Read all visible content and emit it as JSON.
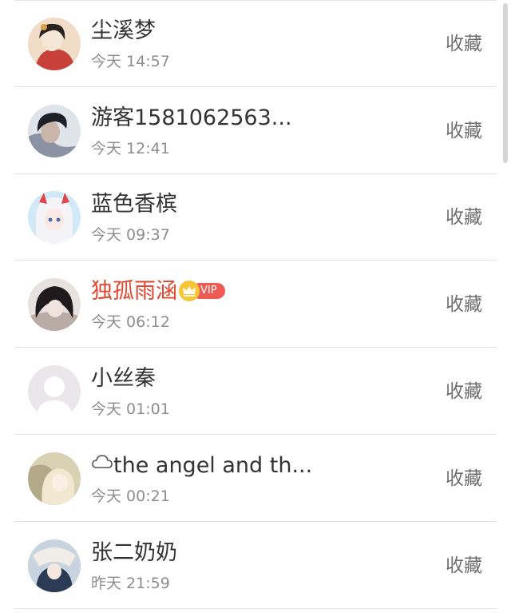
{
  "list": {
    "action_label": "收藏",
    "items": [
      {
        "name": "尘溪梦",
        "time": "今天 14:57",
        "vip": false,
        "avatar": "avatar-girl-red-dress",
        "avatar_colors": [
          "#f1ddc7",
          "#c8403a",
          "#2b2220"
        ]
      },
      {
        "name": "游客1581062563...",
        "time": "今天 12:41",
        "vip": false,
        "avatar": "avatar-boy-dark",
        "avatar_colors": [
          "#dfe3ea",
          "#1e2028",
          "#8a92a4"
        ]
      },
      {
        "name": "蓝色香槟",
        "time": "今天 09:37",
        "vip": false,
        "avatar": "avatar-anime-blue",
        "avatar_colors": [
          "#cfe9f7",
          "#f4f4f6",
          "#e0474d"
        ]
      },
      {
        "name": "独孤雨涵",
        "time": "今天 06:12",
        "vip": true,
        "vip_label": "VIP",
        "avatar": "avatar-dark-hood",
        "avatar_colors": [
          "#e7e2df",
          "#1f1b1d",
          "#b9aba5"
        ]
      },
      {
        "name": "小丝秦",
        "time": "今天 01:01",
        "vip": false,
        "avatar": "avatar-default-silhouette",
        "avatar_colors": [
          "#ebe6ea",
          "#ffffff",
          "#ddd5db"
        ]
      },
      {
        "name": "the angel and th...",
        "time": "今天 00:21",
        "vip": false,
        "prefix_icon": "cloud-icon",
        "avatar": "avatar-anime-blonde",
        "avatar_colors": [
          "#d8d1b4",
          "#f2e7d0",
          "#9b8e6a"
        ]
      },
      {
        "name": "张二奶奶",
        "time": "昨天 21:59",
        "vip": false,
        "avatar": "avatar-anime-fan",
        "avatar_colors": [
          "#c7d3df",
          "#2c3b55",
          "#f0ece8"
        ]
      }
    ]
  },
  "colors": {
    "divider": "#e4e4e4",
    "name_text": "#333333",
    "vip_name_text": "#e0452e",
    "time_text": "#8e8e8e",
    "action_text": "#6e6e6e",
    "vip_pill": "#ee5a54",
    "vip_crown": "#f6c637"
  }
}
